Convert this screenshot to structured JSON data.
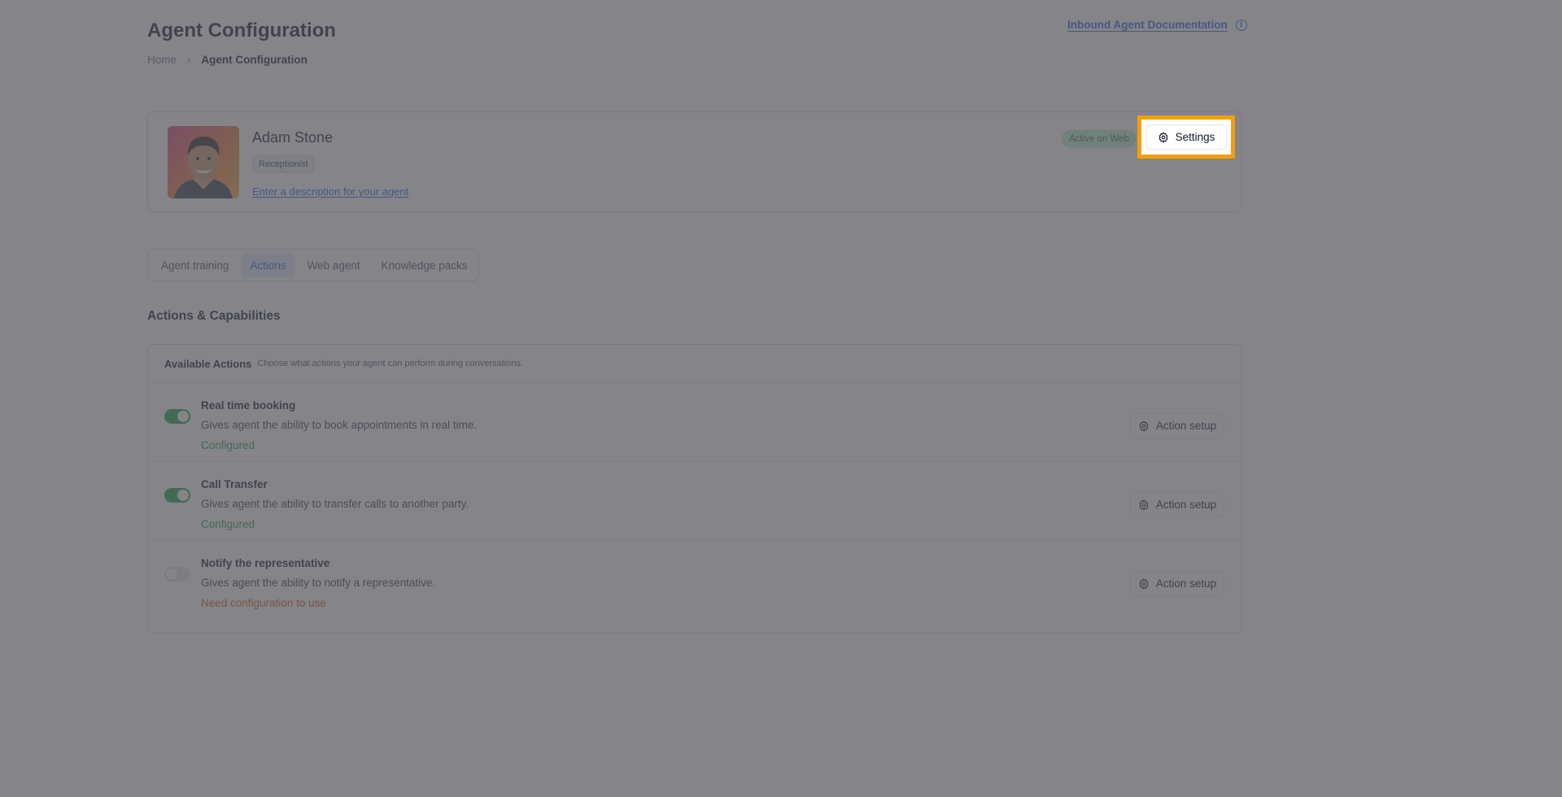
{
  "header": {
    "title": "Agent Configuration",
    "breadcrumb": {
      "home": "Home",
      "separator": "›",
      "current": "Agent Configuration"
    },
    "doc_link": "Inbound Agent Documentation",
    "info_icon": "info-icon"
  },
  "agent": {
    "name": "Adam Stone",
    "role": "Receptionist",
    "description_link": "Enter a description for your agent",
    "status": "Active on Web",
    "settings_label": "Settings",
    "settings_icon": "gear-icon"
  },
  "tabs": [
    {
      "label": "Agent training",
      "active": false
    },
    {
      "label": "Actions",
      "active": true
    },
    {
      "label": "Web agent",
      "active": false
    },
    {
      "label": "Knowledge packs",
      "active": false
    }
  ],
  "section": {
    "title": "Actions & Capabilities"
  },
  "actions_panel": {
    "title": "Available Actions",
    "subtitle": "Choose what actions your agent can perform during conversations.",
    "items": [
      {
        "name": "Real time booking",
        "description": "Gives agent the ability to book appointments in real time.",
        "status": "Configured",
        "enabled": true,
        "button": "Action setup"
      },
      {
        "name": "Call Transfer",
        "description": "Gives agent the ability to transfer calls to another party.",
        "status": "Configured",
        "enabled": true,
        "button": "Action setup"
      },
      {
        "name": "Notify the representative",
        "description": "Gives agent the ability to notify a representative.",
        "status": "Need configuration to use",
        "enabled": false,
        "button": "Action setup"
      }
    ]
  },
  "colors": {
    "accent": "#2563eb",
    "success": "#16a34a",
    "warning": "#ea580c",
    "highlight": "#f59e0b"
  }
}
